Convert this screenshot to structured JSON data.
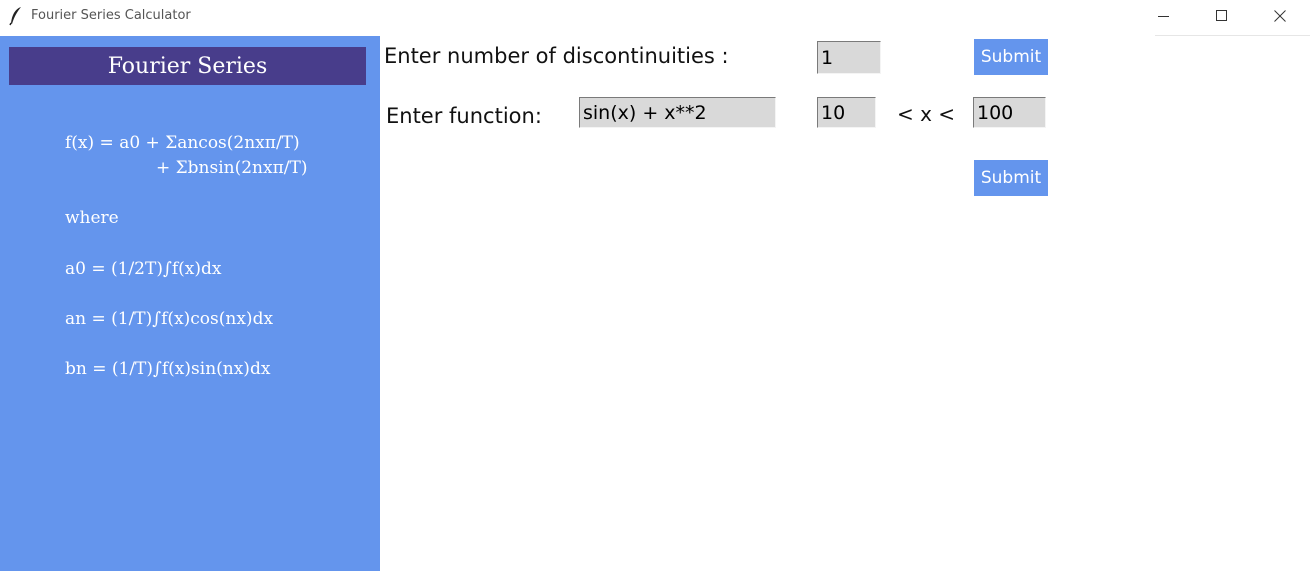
{
  "window": {
    "title": "Fourier Series Calculator",
    "icons": {
      "app": "feather-icon",
      "minimize": "minimize-icon",
      "maximize": "maximize-icon",
      "close": "close-icon"
    }
  },
  "sidebar": {
    "title": "Fourier Series",
    "formula_line1": "f(x) = a0 + Σancos(2nxπ/T)",
    "formula_line2": "+ Σbnsin(2nxπ/T)",
    "where": "where",
    "a0": "a0 = (1/2T)∫f(x)dx",
    "an": "an = (1/T)∫f(x)cos(nx)dx",
    "bn": "bn = (1/T)∫f(x)sin(nx)dx",
    "colors": {
      "panel": "#6495ED",
      "header": "#483D8B"
    }
  },
  "form": {
    "discontinuities_label": "Enter number of discontinuities :",
    "discontinuities_value": "1",
    "submit_discontinuities": "Submit",
    "function_label": "Enter function:",
    "function_value": "sin(x) + x**2",
    "lower_bound": "10",
    "range_label": "< x <",
    "upper_bound": "100",
    "submit_function": "Submit"
  }
}
